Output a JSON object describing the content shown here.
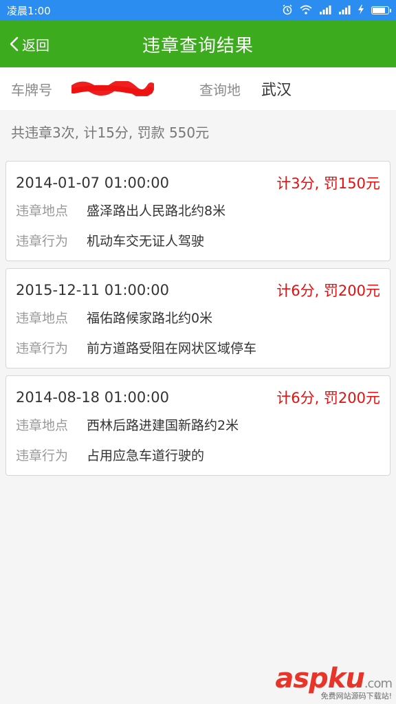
{
  "status_bar": {
    "time": "凌晨1:00",
    "battery_level": 0.85,
    "icons": [
      "alarm-icon",
      "wifi-icon",
      "signal-icon",
      "signal-icon",
      "charging-icon",
      "battery-icon"
    ]
  },
  "header": {
    "back_label": "返回",
    "title": "违章查询结果"
  },
  "info": {
    "plate_label": "车牌号",
    "plate_value_visible": "鄂",
    "query_place_label": "查询地",
    "query_place_value": "武汉"
  },
  "summary": "共违章3次, 计15分, 罚款 550元",
  "violations": [
    {
      "datetime": "2014-01-07 01:00:00",
      "penalty": "计3分, 罚150元",
      "location_label": "违章地点",
      "location": "盛泽路出人民路北约8米",
      "behavior_label": "违章行为",
      "behavior": "机动车交无证人驾驶"
    },
    {
      "datetime": "2015-12-11 01:00:00",
      "penalty": "计6分, 罚200元",
      "location_label": "违章地点",
      "location": "福佑路候家路北约0米",
      "behavior_label": "违章行为",
      "behavior": "前方道路受阻在网状区域停车"
    },
    {
      "datetime": "2014-08-18 01:00:00",
      "penalty": "计6分, 罚200元",
      "location_label": "违章地点",
      "location": "西林后路进建国新路约2米",
      "behavior_label": "违章行为",
      "behavior": "占用应急车道行驶的"
    }
  ],
  "watermark": {
    "asp": "asp",
    "ku": "ku",
    "com": ".com",
    "sub": "免费网站源码下载站!"
  },
  "colors": {
    "status_bar": "#2c8df0",
    "title_bar": "#3cab1e",
    "penalty_red": "#e60e0e"
  }
}
